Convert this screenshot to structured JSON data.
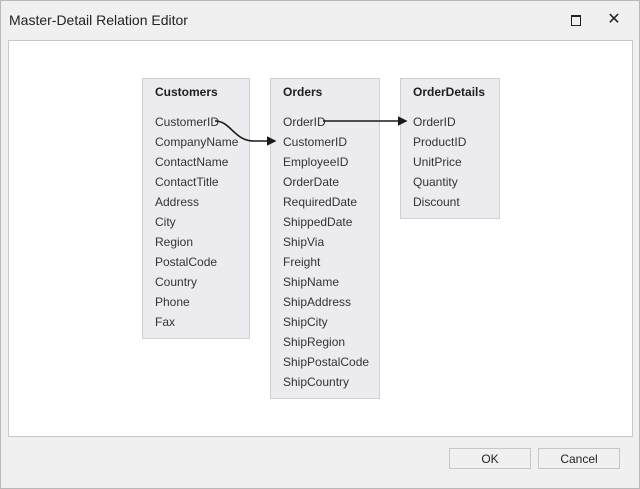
{
  "window": {
    "title": "Master-Detail Relation Editor"
  },
  "tables": [
    {
      "name": "Customers",
      "fields": [
        "CustomerID",
        "CompanyName",
        "ContactName",
        "ContactTitle",
        "Address",
        "City",
        "Region",
        "PostalCode",
        "Country",
        "Phone",
        "Fax"
      ]
    },
    {
      "name": "Orders",
      "fields": [
        "OrderID",
        "CustomerID",
        "EmployeeID",
        "OrderDate",
        "RequiredDate",
        "ShippedDate",
        "ShipVia",
        "Freight",
        "ShipName",
        "ShipAddress",
        "ShipCity",
        "ShipRegion",
        "ShipPostalCode",
        "ShipCountry"
      ]
    },
    {
      "name": "OrderDetails",
      "fields": [
        "OrderID",
        "ProductID",
        "UnitPrice",
        "Quantity",
        "Discount"
      ]
    }
  ],
  "relations": [
    {
      "from_table": "Customers",
      "from_field": "CustomerID",
      "to_table": "Orders",
      "to_field": "CustomerID"
    },
    {
      "from_table": "Orders",
      "from_field": "OrderID",
      "to_table": "OrderDetails",
      "to_field": "OrderID"
    }
  ],
  "buttons": {
    "ok": "OK",
    "cancel": "Cancel"
  },
  "icons": {
    "maximize": "maximize-icon",
    "close": "close-icon"
  },
  "colors": {
    "table_bg": "#ececf0",
    "table_border": "#cfcfd4",
    "relation_line": "#1a1a1a"
  }
}
